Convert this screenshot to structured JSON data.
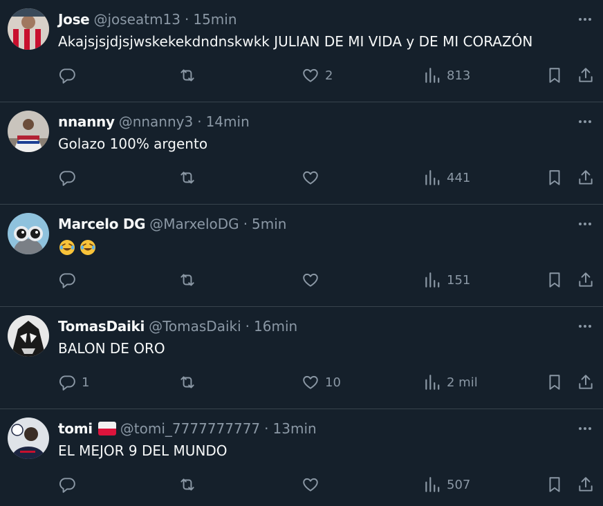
{
  "colors": {
    "background": "#15202b",
    "divider": "#38444d",
    "text_primary": "#f7f9f9",
    "text_secondary": "#8b98a5"
  },
  "icons": {
    "reply": "reply-icon",
    "retweet": "retweet-icon",
    "like": "heart-icon",
    "views": "views-icon",
    "bookmark": "bookmark-icon",
    "share": "share-icon",
    "more": "more-icon"
  },
  "tweets": [
    {
      "name": "Jose",
      "handle": "@joseatm13",
      "time": "15min",
      "text": "Akajsjsjdjsjwskekekdndnskwkk JULIAN DE MI VIDA y DE MI CORAZÓN",
      "replies": "",
      "retweets": "",
      "likes": "2",
      "views": "813"
    },
    {
      "name": "nnanny",
      "handle": "@nnanny3",
      "time": "14min",
      "text": "Golazo 100% argento",
      "replies": "",
      "retweets": "",
      "likes": "",
      "views": "441"
    },
    {
      "name": "Marcelo DG",
      "handle": "@MarxeloDG",
      "time": "5min",
      "text": "",
      "emojis": [
        "rolling-on-floor-laughing",
        "rolling-on-floor-laughing"
      ],
      "replies": "",
      "retweets": "",
      "likes": "",
      "views": "151"
    },
    {
      "name": "TomasDaiki",
      "handle": "@TomasDaiki",
      "time": "16min",
      "text": "BALON DE ORO",
      "replies": "1",
      "retweets": "",
      "likes": "10",
      "views": "2 mil"
    },
    {
      "name": "tomi",
      "flag": "poland-flag",
      "handle": "@tomi_7777777777",
      "time": "13min",
      "text": "EL MEJOR 9 DEL MUNDO",
      "replies": "",
      "retweets": "",
      "likes": "",
      "views": "507"
    }
  ]
}
